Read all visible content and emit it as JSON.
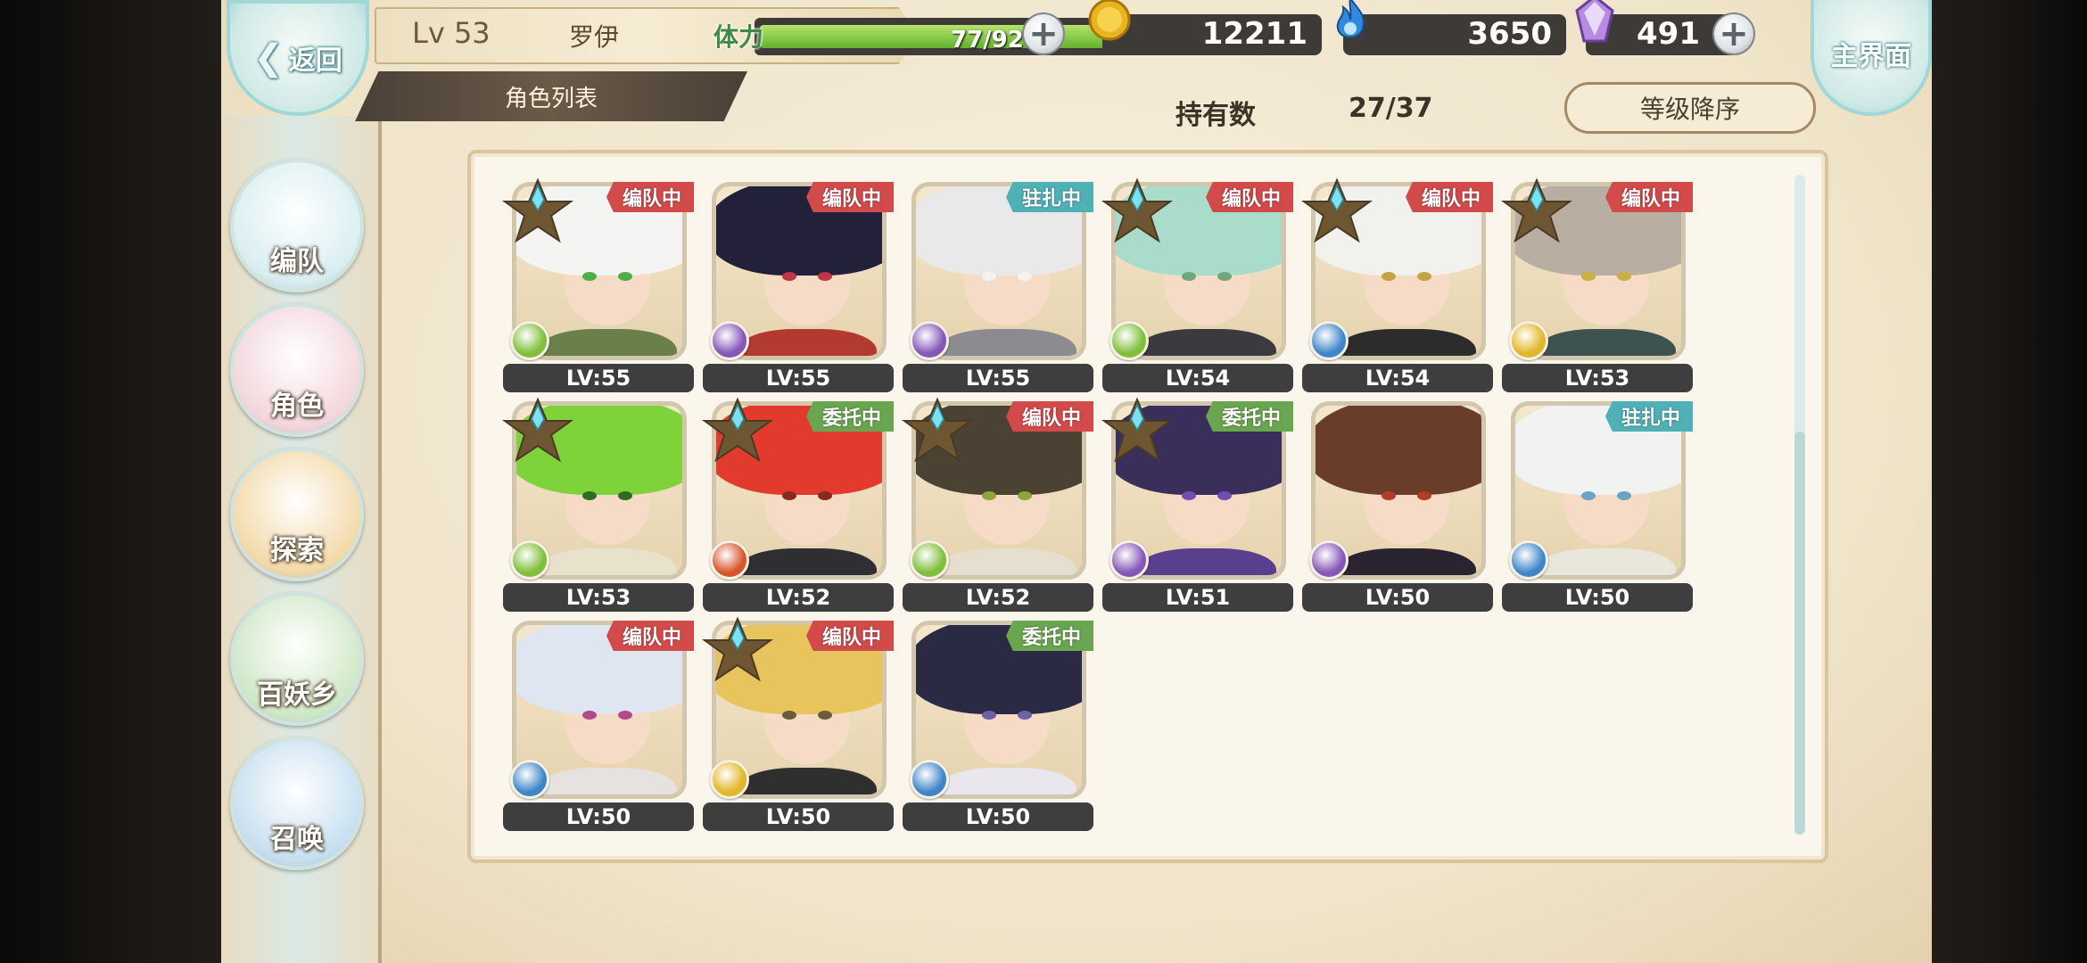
{
  "header": {
    "back_label": "返回",
    "player_level": "Lv 53",
    "player_name": "罗伊",
    "tab_label": "角色列表",
    "stamina_label": "体力",
    "stamina_text": "77/92",
    "stamina_fraction": 0.837,
    "gold": "12211",
    "soul_fire": "3650",
    "crystal": "491",
    "home_label": "主界面"
  },
  "roster": {
    "owned_label": "持有数",
    "owned_count": "27/37",
    "sort_label": "等级降序"
  },
  "nav": [
    {
      "label": "编队",
      "color": "#d9eef0"
    },
    {
      "label": "角色",
      "color": "#f3d6dc"
    },
    {
      "label": "探索",
      "color": "#f3d9a8"
    },
    {
      "label": "百妖乡",
      "color": "#cfe8c6"
    },
    {
      "label": "召唤",
      "color": "#c7dff0"
    }
  ],
  "colors": {
    "tag_team": "#d24a4a",
    "tag_station": "#4fb0b6",
    "tag_commission": "#6aa54f",
    "element_wind": "#7fbf3a",
    "element_dark": "#8557b8",
    "element_water": "#3f86c8",
    "element_fire": "#d9552a",
    "element_light": "#e2b626"
  },
  "characters": [
    {
      "level": "LV:55",
      "tag": "编队中",
      "tag_type": "team",
      "star": true,
      "element": "wind",
      "hair": "#f4f4f2",
      "eye": "#4fae4a",
      "cloth": "#6b7f4a"
    },
    {
      "level": "LV:55",
      "tag": "编队中",
      "tag_type": "team",
      "star": false,
      "element": "dark",
      "hair": "#23213a",
      "eye": "#c2344a",
      "cloth": "#b23a2e"
    },
    {
      "level": "LV:55",
      "tag": "驻扎中",
      "tag_type": "station",
      "star": false,
      "element": "dark",
      "hair": "#e9e9ea",
      "eye": "#f3f3f3",
      "cloth": "#8d8b92"
    },
    {
      "level": "LV:54",
      "tag": "编队中",
      "tag_type": "team",
      "star": true,
      "element": "wind",
      "hair": "#a9dccb",
      "eye": "#6fa77c",
      "cloth": "#3b3b3f"
    },
    {
      "level": "LV:54",
      "tag": "编队中",
      "tag_type": "team",
      "star": true,
      "element": "water",
      "hair": "#f1f1ee",
      "eye": "#c4a342",
      "cloth": "#2c2c2c"
    },
    {
      "level": "LV:53",
      "tag": "编队中",
      "tag_type": "team",
      "star": true,
      "element": "light",
      "hair": "#b9aea2",
      "eye": "#c9b041",
      "cloth": "#3e5250"
    },
    {
      "level": "LV:53",
      "tag": "",
      "tag_type": "",
      "star": true,
      "element": "wind",
      "hair": "#7ed23a",
      "eye": "#2f6b25",
      "cloth": "#e8e1cc"
    },
    {
      "level": "LV:52",
      "tag": "委托中",
      "tag_type": "commission",
      "star": true,
      "element": "fire",
      "hair": "#e23a2c",
      "eye": "#8a2a1e",
      "cloth": "#2f2f33"
    },
    {
      "level": "LV:52",
      "tag": "编队中",
      "tag_type": "team",
      "star": true,
      "element": "wind",
      "hair": "#4b4233",
      "eye": "#8fa43a",
      "cloth": "#e6dfcf"
    },
    {
      "level": "LV:51",
      "tag": "委托中",
      "tag_type": "commission",
      "star": true,
      "element": "dark",
      "hair": "#3a2f5a",
      "eye": "#6f4fb4",
      "cloth": "#5b3f8f"
    },
    {
      "level": "LV:50",
      "tag": "",
      "tag_type": "",
      "star": false,
      "element": "dark",
      "hair": "#6a3d2b",
      "eye": "#b53a2a",
      "cloth": "#2a2430"
    },
    {
      "level": "LV:50",
      "tag": "驻扎中",
      "tag_type": "station",
      "star": false,
      "element": "water",
      "hair": "#f2f2f2",
      "eye": "#6aa3c3",
      "cloth": "#e9e6dc"
    },
    {
      "level": "LV:50",
      "tag": "编队中",
      "tag_type": "team",
      "star": false,
      "element": "water",
      "hair": "#dfe6f2",
      "eye": "#b04a8a",
      "cloth": "#e5e2e0"
    },
    {
      "level": "LV:50",
      "tag": "编队中",
      "tag_type": "team",
      "star": true,
      "element": "light",
      "hair": "#e7c45c",
      "eye": "#6b5b3a",
      "cloth": "#2f2f2f"
    },
    {
      "level": "LV:50",
      "tag": "委托中",
      "tag_type": "commission",
      "star": false,
      "element": "water",
      "hair": "#2a2a44",
      "eye": "#6f5fa8",
      "cloth": "#e9e6ee"
    }
  ]
}
